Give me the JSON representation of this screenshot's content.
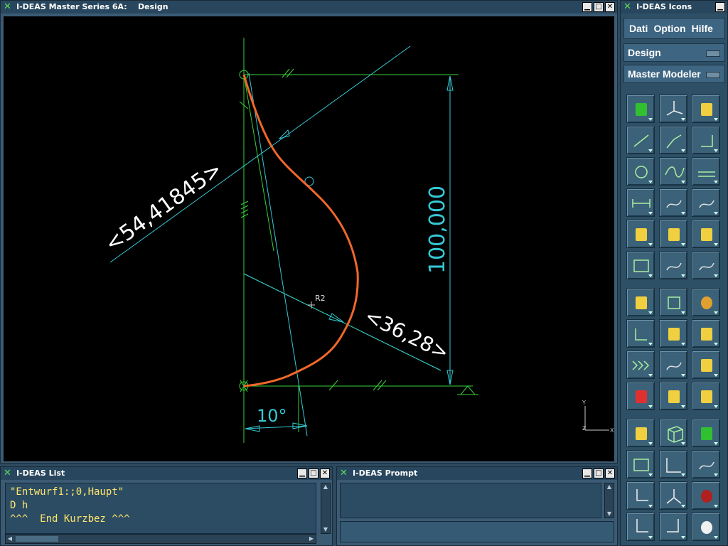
{
  "design_window": {
    "title": "I-DEAS Master Series 6A:    Design"
  },
  "drawing": {
    "dimension_angle_label": "<54,41845>",
    "dimension_height_label": "100,000",
    "dimension_horizontal_label": "<36,28>",
    "angle_label": "10°",
    "point_label": "R2",
    "triad_y": "Y",
    "triad_z": "Z",
    "triad_x": "X"
  },
  "icons_window": {
    "title": "I-DEAS Icons",
    "menu": [
      "Dati",
      "Option",
      "Hilfe"
    ],
    "task_selector": "Design",
    "application_selector": "Master Modeler",
    "buttons": [
      "workplane-icon",
      "axes-xyz-icon",
      "mold-icon",
      "line-icon",
      "polyline-icon",
      "corner-icon",
      "circle-icon",
      "spline-icon",
      "offset-icon",
      "dimension-icon",
      "arc-constraint-icon",
      "sketch-icon",
      "extrude-icon",
      "surface-icon",
      "boolean-icon",
      "rectangle-icon",
      "freeform-icon",
      "move-icon",
      "node-tree-icon",
      "section-box-icon",
      "mesh-sphere-icon",
      "select-arrow-icon",
      "info-icon",
      "paintbrush-icon",
      "triple-arrow-icon",
      "ruler-icon",
      "feature-icon",
      "erase-icon",
      "store-icon",
      "library-icon",
      "display-icon",
      "wireframe-cube-icon",
      "shaded-cube-icon",
      "zoom-box-icon",
      "view-corner-icon",
      "view-eye-icon",
      "view-xz-icon",
      "view-iso-icon",
      "stop-icon",
      "view-yx-icon",
      "view-zy-icon",
      "redraw-icon"
    ]
  },
  "list_window": {
    "title": "I-DEAS List",
    "lines": [
      "\"Entwurf1:;0,Haupt\"",
      "D h",
      "^^^  End Kurzbez ^^^"
    ]
  },
  "prompt_window": {
    "title": "I-DEAS Prompt",
    "prompt_text": "",
    "input_value": ""
  },
  "window_controls": {
    "minimize": "▁",
    "maximize": "□",
    "close": "✕"
  }
}
